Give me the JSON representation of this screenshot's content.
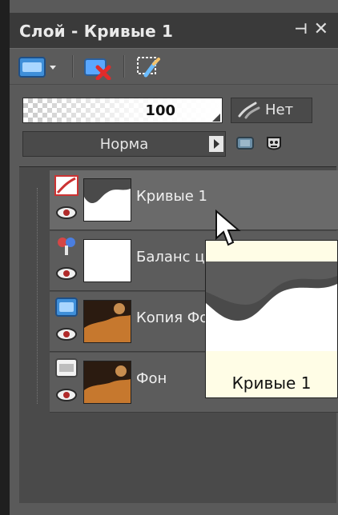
{
  "panel": {
    "title": "Слой - Кривые 1",
    "pin_glyph": "⊣",
    "close_glyph": "✕"
  },
  "toolbar": {
    "items": [
      {
        "icon": "new-layer-icon",
        "has_dropdown": true
      },
      {
        "icon": "delete-layer-icon"
      },
      {
        "icon": "mask-brush-icon"
      }
    ]
  },
  "opacity": {
    "value": "100"
  },
  "mask_link": {
    "label": "Нет"
  },
  "blend": {
    "value": "Норма"
  },
  "layers": [
    {
      "name": "Кривые 1",
      "type_icon": "curves-adjustment-icon",
      "selected": true,
      "thumb": "curves-mask"
    },
    {
      "name": "Баланс цв",
      "type_icon": "color-balance-icon",
      "selected": false,
      "thumb": "white"
    },
    {
      "name": "Копия Фо",
      "type_icon": "raster-copy-icon",
      "selected": false,
      "thumb": "photo"
    },
    {
      "name": "Фон",
      "type_icon": "background-layer-icon",
      "selected": false,
      "thumb": "photo"
    }
  ],
  "tooltip": {
    "label": "Кривые 1"
  },
  "colors": {
    "panel_bg": "#5a5a5a",
    "titlebar_bg": "#3a3a3a",
    "selected_row_bg": "#6a6a6a",
    "tooltip_bg": "#fffde6"
  }
}
